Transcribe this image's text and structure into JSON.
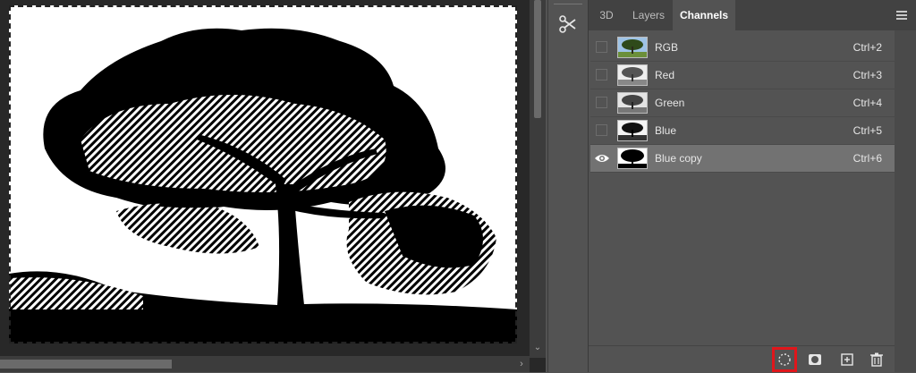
{
  "panel": {
    "tabs": [
      {
        "label": "3D",
        "active": false
      },
      {
        "label": "Layers",
        "active": false
      },
      {
        "label": "Channels",
        "active": true
      }
    ]
  },
  "channels": [
    {
      "name": "RGB",
      "shortcut": "Ctrl+2",
      "visible": false,
      "selected": false,
      "thumb": "color"
    },
    {
      "name": "Red",
      "shortcut": "Ctrl+3",
      "visible": false,
      "selected": false,
      "thumb": "gray-light"
    },
    {
      "name": "Green",
      "shortcut": "Ctrl+4",
      "visible": false,
      "selected": false,
      "thumb": "gray-mid"
    },
    {
      "name": "Blue",
      "shortcut": "Ctrl+5",
      "visible": false,
      "selected": false,
      "thumb": "gray-dark"
    },
    {
      "name": "Blue copy",
      "shortcut": "Ctrl+6",
      "visible": true,
      "selected": true,
      "thumb": "bw"
    }
  ],
  "bottom_buttons": [
    {
      "icon": "load-selection-icon",
      "highlighted": true
    },
    {
      "icon": "save-selection-mask-icon",
      "highlighted": false
    },
    {
      "icon": "new-channel-icon",
      "highlighted": false
    },
    {
      "icon": "delete-channel-icon",
      "highlighted": false
    }
  ],
  "colors": {
    "highlight": "#e0161b",
    "selected_row": "#727272",
    "panel_bg": "#535353"
  }
}
